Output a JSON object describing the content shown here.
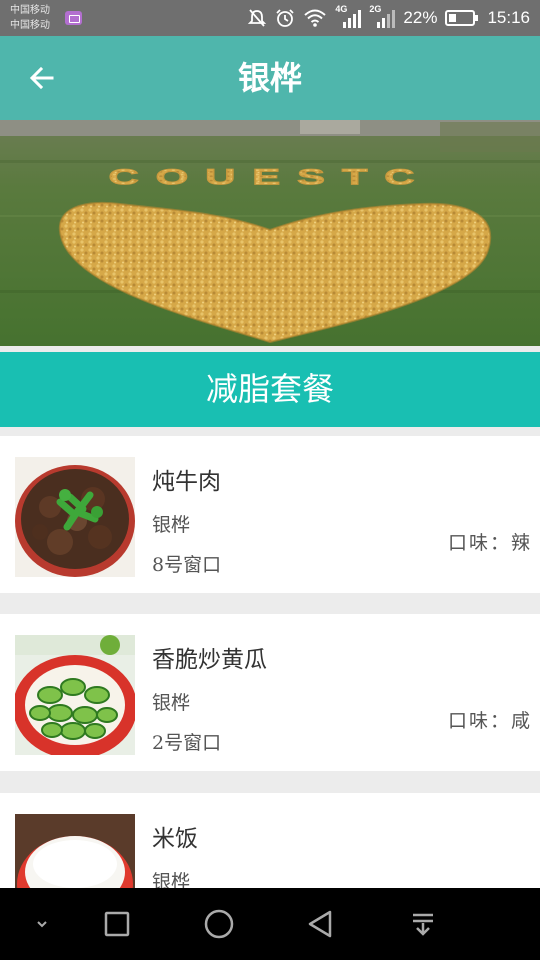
{
  "status_bar": {
    "carrier_1": "中国移动",
    "carrier_2": "中国移动",
    "battery": "22%",
    "time": "15:16",
    "network_1": "4G",
    "network_2": "2G",
    "icons": [
      "gallery-icon",
      "mute-icon",
      "alarm-icon",
      "wifi-icon",
      "signal-icon",
      "battery-icon"
    ]
  },
  "toolbar": {
    "title": "银桦",
    "back_icon": "arrow-left-icon"
  },
  "banner": {
    "letters": "COUESTC"
  },
  "section": {
    "title": "减脂套餐"
  },
  "dishes": [
    {
      "name": "炖牛肉",
      "canteen": "银桦",
      "window": "8号窗口",
      "taste": "口味：辣"
    },
    {
      "name": "香脆炒黄瓜",
      "canteen": "银桦",
      "window": "2号窗口",
      "taste": "口味：咸"
    },
    {
      "name": "米饭",
      "canteen": "银桦",
      "window": "",
      "taste": ""
    }
  ],
  "nav_bar": {
    "icons": [
      "chevron-down-icon",
      "recents-icon",
      "home-icon",
      "back-icon",
      "notification-pull-icon"
    ]
  },
  "colors": {
    "toolbar": "#4fb6ac",
    "section": "#19bfb2",
    "status_bar": "#6f6f6f"
  }
}
